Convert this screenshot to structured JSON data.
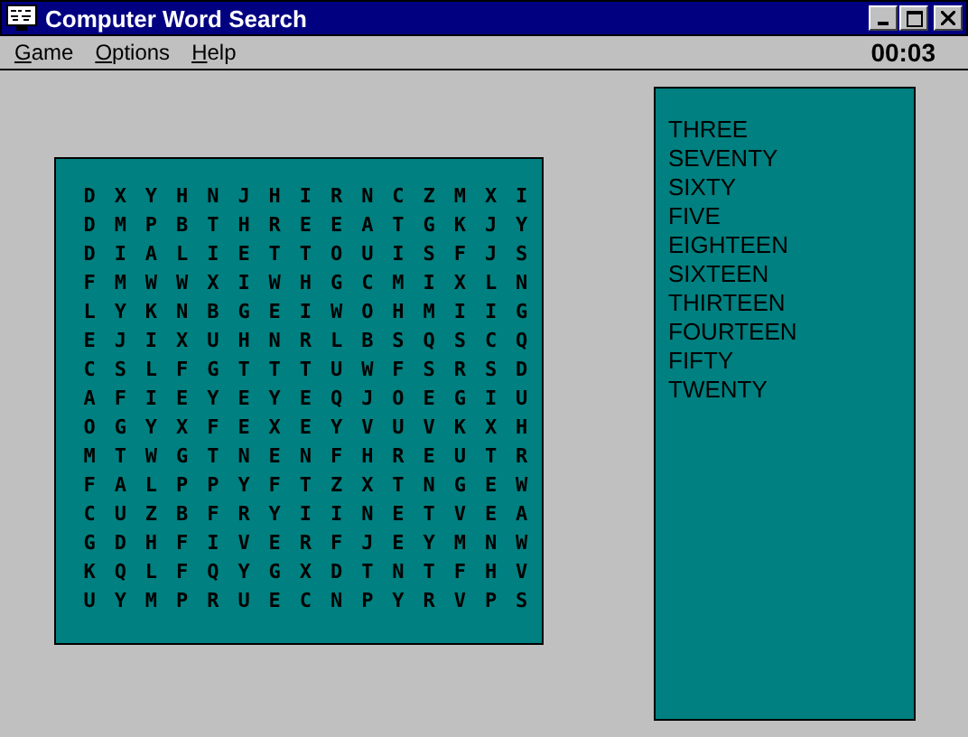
{
  "window": {
    "title": "Computer Word Search"
  },
  "menu": [
    {
      "label": "Game"
    },
    {
      "label": "Options"
    },
    {
      "label": "Help"
    }
  ],
  "timer": "00:03",
  "grid": [
    [
      "D",
      "X",
      "Y",
      "H",
      "N",
      "J",
      "H",
      "I",
      "R",
      "N",
      "C",
      "Z",
      "M",
      "X",
      "I"
    ],
    [
      "D",
      "M",
      "P",
      "B",
      "T",
      "H",
      "R",
      "E",
      "E",
      "A",
      "T",
      "G",
      "K",
      "J",
      "Y"
    ],
    [
      "D",
      "I",
      "A",
      "L",
      "I",
      "E",
      "T",
      "T",
      "O",
      "U",
      "I",
      "S",
      "F",
      "J",
      "S"
    ],
    [
      "F",
      "M",
      "W",
      "W",
      "X",
      "I",
      "W",
      "H",
      "G",
      "C",
      "M",
      "I",
      "X",
      "L",
      "N"
    ],
    [
      "L",
      "Y",
      "K",
      "N",
      "B",
      "G",
      "E",
      "I",
      "W",
      "O",
      "H",
      "M",
      "I",
      "I",
      "G"
    ],
    [
      "E",
      "J",
      "I",
      "X",
      "U",
      "H",
      "N",
      "R",
      "L",
      "B",
      "S",
      "Q",
      "S",
      "C",
      "Q"
    ],
    [
      "C",
      "S",
      "L",
      "F",
      "G",
      "T",
      "T",
      "T",
      "U",
      "W",
      "F",
      "S",
      "R",
      "S",
      "D"
    ],
    [
      "A",
      "F",
      "I",
      "E",
      "Y",
      "E",
      "Y",
      "E",
      "Q",
      "J",
      "O",
      "E",
      "G",
      "I",
      "U"
    ],
    [
      "O",
      "G",
      "Y",
      "X",
      "F",
      "E",
      "X",
      "E",
      "Y",
      "V",
      "U",
      "V",
      "K",
      "X",
      "H"
    ],
    [
      "M",
      "T",
      "W",
      "G",
      "T",
      "N",
      "E",
      "N",
      "F",
      "H",
      "R",
      "E",
      "U",
      "T",
      "R"
    ],
    [
      "F",
      "A",
      "L",
      "P",
      "P",
      "Y",
      "F",
      "T",
      "Z",
      "X",
      "T",
      "N",
      "G",
      "E",
      "W"
    ],
    [
      "C",
      "U",
      "Z",
      "B",
      "F",
      "R",
      "Y",
      "I",
      "I",
      "N",
      "E",
      "T",
      "V",
      "E",
      "A"
    ],
    [
      "G",
      "D",
      "H",
      "F",
      "I",
      "V",
      "E",
      "R",
      "F",
      "J",
      "E",
      "Y",
      "M",
      "N",
      "W"
    ],
    [
      "K",
      "Q",
      "L",
      "F",
      "Q",
      "Y",
      "G",
      "X",
      "D",
      "T",
      "N",
      "T",
      "F",
      "H",
      "V"
    ],
    [
      "U",
      "Y",
      "M",
      "P",
      "R",
      "U",
      "E",
      "C",
      "N",
      "P",
      "Y",
      "R",
      "V",
      "P",
      "S"
    ]
  ],
  "words": [
    "THREE",
    "SEVENTY",
    "SIXTY",
    "FIVE",
    "EIGHTEEN",
    "SIXTEEN",
    "THIRTEEN",
    "FOURTEEN",
    "FIFTY",
    "TWENTY"
  ]
}
